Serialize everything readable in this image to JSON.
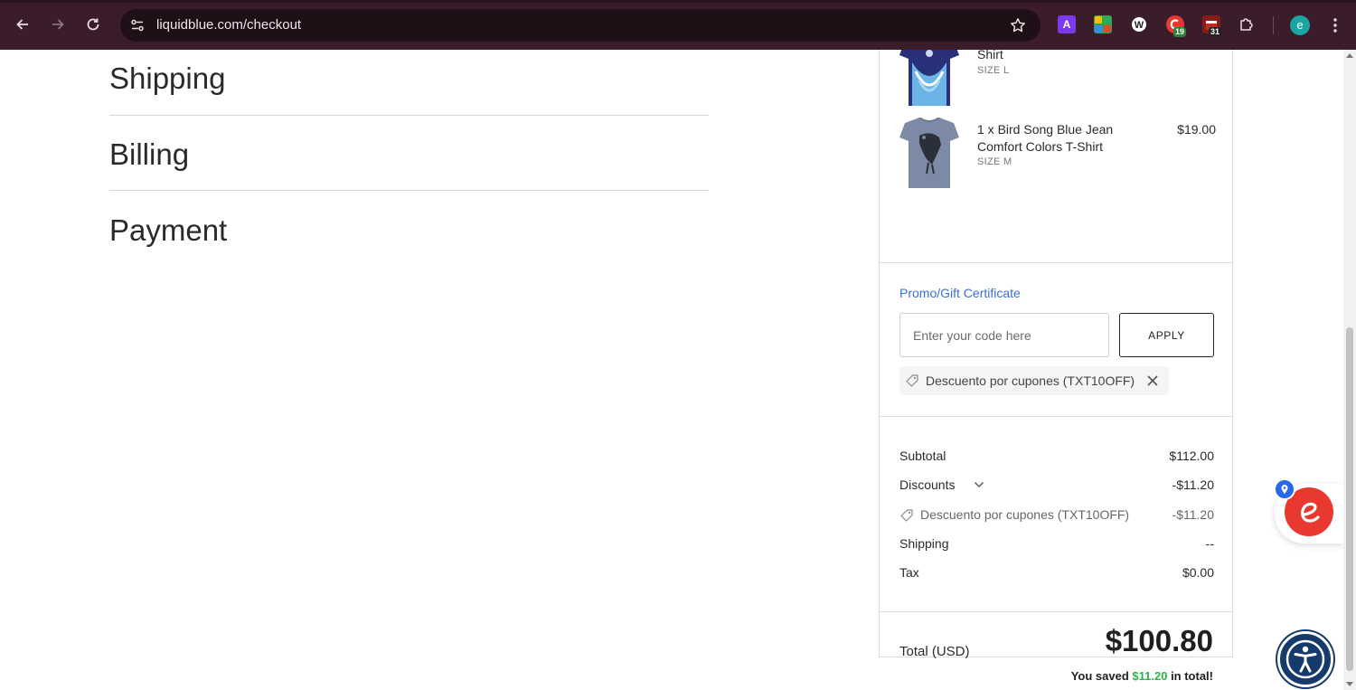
{
  "browser": {
    "url": "liquidblue.com/checkout",
    "extensions": [
      {
        "name": "adblock-a",
        "label": "A",
        "color": "#7c3aed"
      },
      {
        "name": "colorful-ext",
        "label": "",
        "color": "#2ea44f"
      },
      {
        "name": "w-ext",
        "label": "W",
        "color": "#333333"
      },
      {
        "name": "red-ext",
        "label": "",
        "color": "#e53935",
        "badge": "19",
        "badge_color": "#2e7d32"
      },
      {
        "name": "calendar-ext",
        "label": "",
        "color": "#8b1a1a",
        "badge": "31",
        "badge_color": "#222222"
      }
    ],
    "profile_initial": "e"
  },
  "checkout": {
    "sections": [
      "Shipping",
      "Billing",
      "Payment"
    ]
  },
  "order_summary": {
    "items": [
      {
        "name": "Shirt",
        "size": "SIZE L",
        "price": ""
      },
      {
        "name": "1 x Bird Song Blue Jean Comfort Colors T-Shirt",
        "size": "SIZE M",
        "price": "$19.00"
      }
    ],
    "promo": {
      "link_label": "Promo/Gift Certificate",
      "placeholder": "Enter your code here",
      "apply_label": "APPLY",
      "applied_code": "Descuento por cupones (TXT10OFF)"
    },
    "totals": {
      "subtotal_label": "Subtotal",
      "subtotal": "$112.00",
      "discounts_label": "Discounts",
      "discounts": "-$11.20",
      "coupon_label": "Descuento por cupones (TXT10OFF)",
      "coupon_value": "-$11.20",
      "shipping_label": "Shipping",
      "shipping": "--",
      "tax_label": "Tax",
      "tax": "$0.00",
      "total_label": "Total (USD)",
      "total": "$100.80",
      "saved_prefix": "You saved",
      "saved_amount": "$11.20",
      "saved_suffix": "in total!"
    }
  },
  "colors": {
    "chrome": "#3a1c2a",
    "link": "#3b6fd6",
    "savings": "#2bb24c",
    "widget_red": "#e8382f",
    "a11y_blue": "#163a6b"
  }
}
